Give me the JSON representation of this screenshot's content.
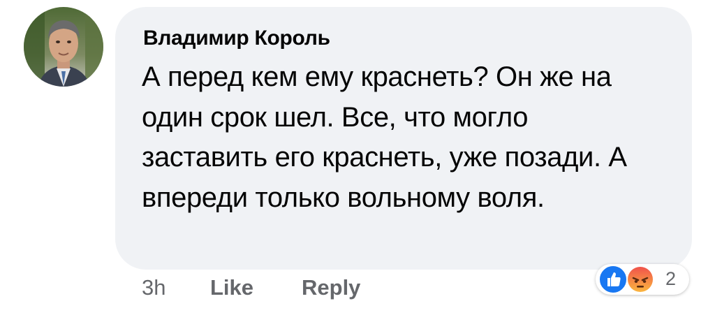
{
  "comment": {
    "author": "Владимир Король",
    "text": "А перед кем ему краснеть? Он же на один срок шел. Все, что могло заставить его краснеть, уже позади. А впереди только вольному воля."
  },
  "actions": {
    "time": "3h",
    "like_label": "Like",
    "reply_label": "Reply"
  },
  "reactions": {
    "icons": [
      "like-icon",
      "angry-icon"
    ],
    "count": "2",
    "colors": {
      "like": "#1877f2",
      "angry": "#f0524b"
    }
  },
  "theme": {
    "bubble_bg": "#f0f2f5",
    "text": "#050505",
    "secondary_text": "#65676b"
  }
}
